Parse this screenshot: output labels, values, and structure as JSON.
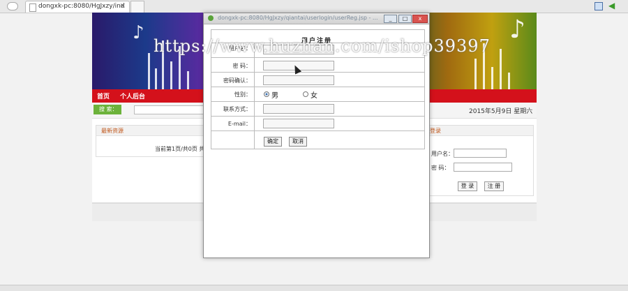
{
  "browser": {
    "tab_title": "dongxk-pc:8080/HgJxzy/ind",
    "tab_close": "×"
  },
  "site": {
    "nav": {
      "home": "首页",
      "user_center": "个人后台"
    },
    "search_label": "搜 索：",
    "date": "2015年5月9日 星期六",
    "latest_panel": {
      "title": "最新资源",
      "pager": "当前第1页/共0页 共"
    },
    "login_panel": {
      "title": "登录",
      "username_label": "用户名：",
      "password_label": "密  码：",
      "login_button": "登 录",
      "register_button": "注 册"
    }
  },
  "popup": {
    "url": "dongxk-pc:8080/HgJxzy/qiantai/userlogin/userReg.jsp - ...",
    "min": "_",
    "max": "□",
    "close": "x",
    "form": {
      "title": "用户注册",
      "fields": [
        {
          "label": "用户名："
        },
        {
          "label": "密  码："
        },
        {
          "label": "密码确认："
        },
        {
          "label": "性别："
        },
        {
          "label": "联系方式："
        },
        {
          "label": "E-mail："
        }
      ],
      "gender": {
        "male": "男",
        "female": "女",
        "selected": "男"
      },
      "confirm_button": "确定",
      "cancel_button": "取消"
    }
  },
  "watermark": "https://www.huzhan.com/ishop39397",
  "colors": {
    "nav_red": "#d4111b",
    "search_green": "#6cb23a",
    "panel_title": "#c0561a"
  }
}
